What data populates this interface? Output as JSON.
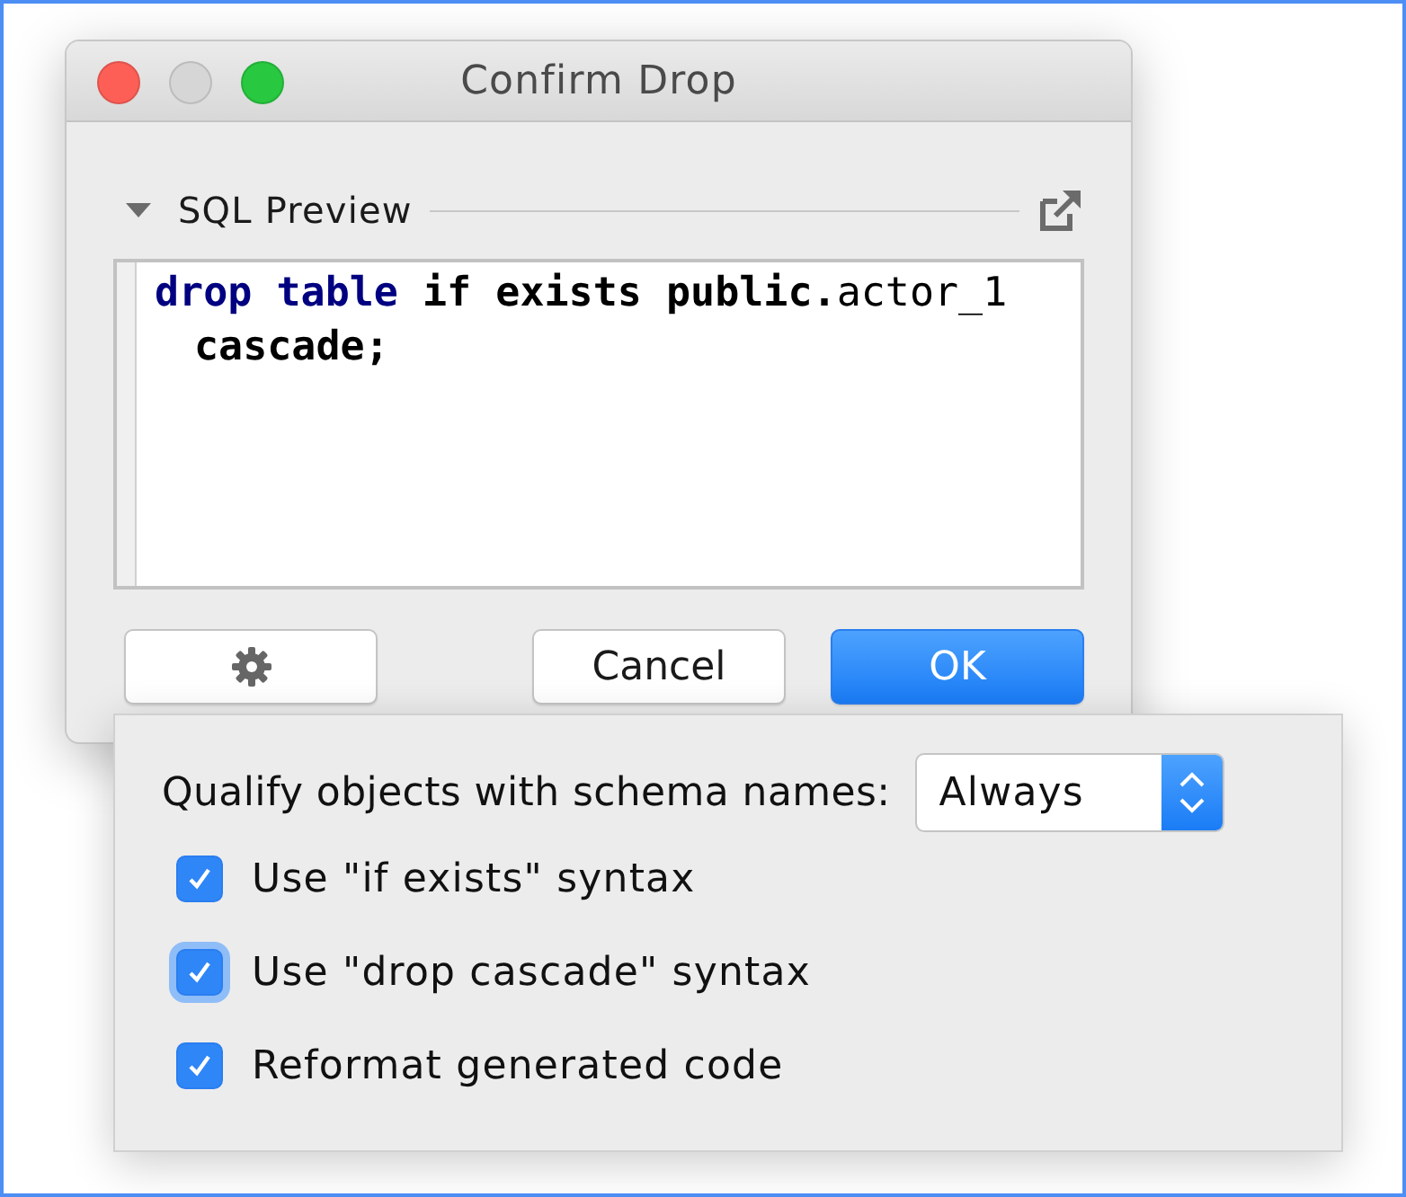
{
  "window": {
    "title": "Confirm Drop"
  },
  "window_controls": [
    {
      "color": "#fd5f57"
    },
    {
      "color": "#d6d6d6"
    },
    {
      "color": "#28c840"
    }
  ],
  "sql_preview": {
    "title": "SQL Preview",
    "expanded": true,
    "lines": [
      {
        "tokens": [
          {
            "kind": "keyword",
            "text": "drop "
          },
          {
            "kind": "keyword",
            "text": "table "
          },
          {
            "kind": "bold",
            "text": "if exists public."
          },
          {
            "kind": "plain",
            "text": "actor_1"
          }
        ]
      },
      {
        "tokens": [
          {
            "kind": "bold",
            "text": "cascade;"
          }
        ]
      }
    ]
  },
  "buttons": [
    {
      "kind": "settings"
    },
    {
      "kind": "text",
      "label": "Cancel",
      "default": false
    },
    {
      "kind": "text",
      "label": "OK",
      "default": true
    }
  ],
  "options_popup": {
    "qualify_label": "Qualify objects with schema names:",
    "qualify_value": "Always",
    "checkboxes": [
      {
        "label": "Use \"if exists\" syntax",
        "checked": true,
        "focused": false
      },
      {
        "label": "Use \"drop cascade\" syntax",
        "checked": true,
        "focused": true
      },
      {
        "label": "Reformat generated code",
        "checked": true,
        "focused": false
      }
    ]
  }
}
